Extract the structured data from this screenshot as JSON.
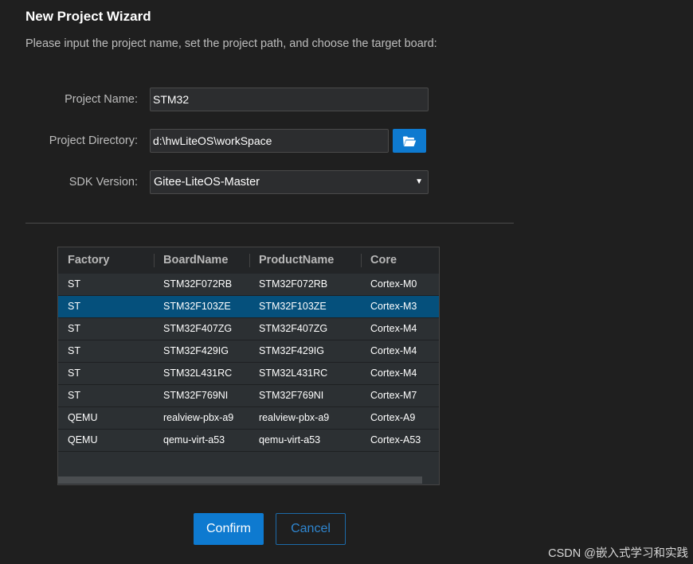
{
  "wizard": {
    "title": "New Project Wizard",
    "subtitle": "Please input the project name, set the project path, and choose the target board:"
  },
  "form": {
    "project_name_label": "Project Name:",
    "project_name_value": "STM32",
    "project_dir_label": "Project Directory:",
    "project_dir_value": "d:\\hwLiteOS\\workSpace",
    "browse_icon": "folder-open-icon",
    "sdk_version_label": "SDK Version:",
    "sdk_version_selected": "Gitee-LiteOS-Master"
  },
  "board_table": {
    "columns": [
      "Factory",
      "BoardName",
      "ProductName",
      "Core"
    ],
    "rows": [
      {
        "factory": "ST",
        "board": "STM32F072RB",
        "product": "STM32F072RB",
        "core": "Cortex-M0",
        "selected": false
      },
      {
        "factory": "ST",
        "board": "STM32F103ZE",
        "product": "STM32F103ZE",
        "core": "Cortex-M3",
        "selected": true
      },
      {
        "factory": "ST",
        "board": "STM32F407ZG",
        "product": "STM32F407ZG",
        "core": "Cortex-M4",
        "selected": false
      },
      {
        "factory": "ST",
        "board": "STM32F429IG",
        "product": "STM32F429IG",
        "core": "Cortex-M4",
        "selected": false
      },
      {
        "factory": "ST",
        "board": "STM32L431RC",
        "product": "STM32L431RC",
        "core": "Cortex-M4",
        "selected": false
      },
      {
        "factory": "ST",
        "board": "STM32F769NI",
        "product": "STM32F769NI",
        "core": "Cortex-M7",
        "selected": false
      },
      {
        "factory": "QEMU",
        "board": "realview-pbx-a9",
        "product": "realview-pbx-a9",
        "core": "Cortex-A9",
        "selected": false
      },
      {
        "factory": "QEMU",
        "board": "qemu-virt-a53",
        "product": "qemu-virt-a53",
        "core": "Cortex-A53",
        "selected": false
      }
    ]
  },
  "buttons": {
    "confirm_label": "Confirm",
    "cancel_label": "Cancel"
  },
  "watermark": "CSDN @嵌入式学习和实践",
  "colors": {
    "background": "#1f1f1f",
    "accent": "#0e7ad0",
    "selected_row": "#05507c"
  }
}
